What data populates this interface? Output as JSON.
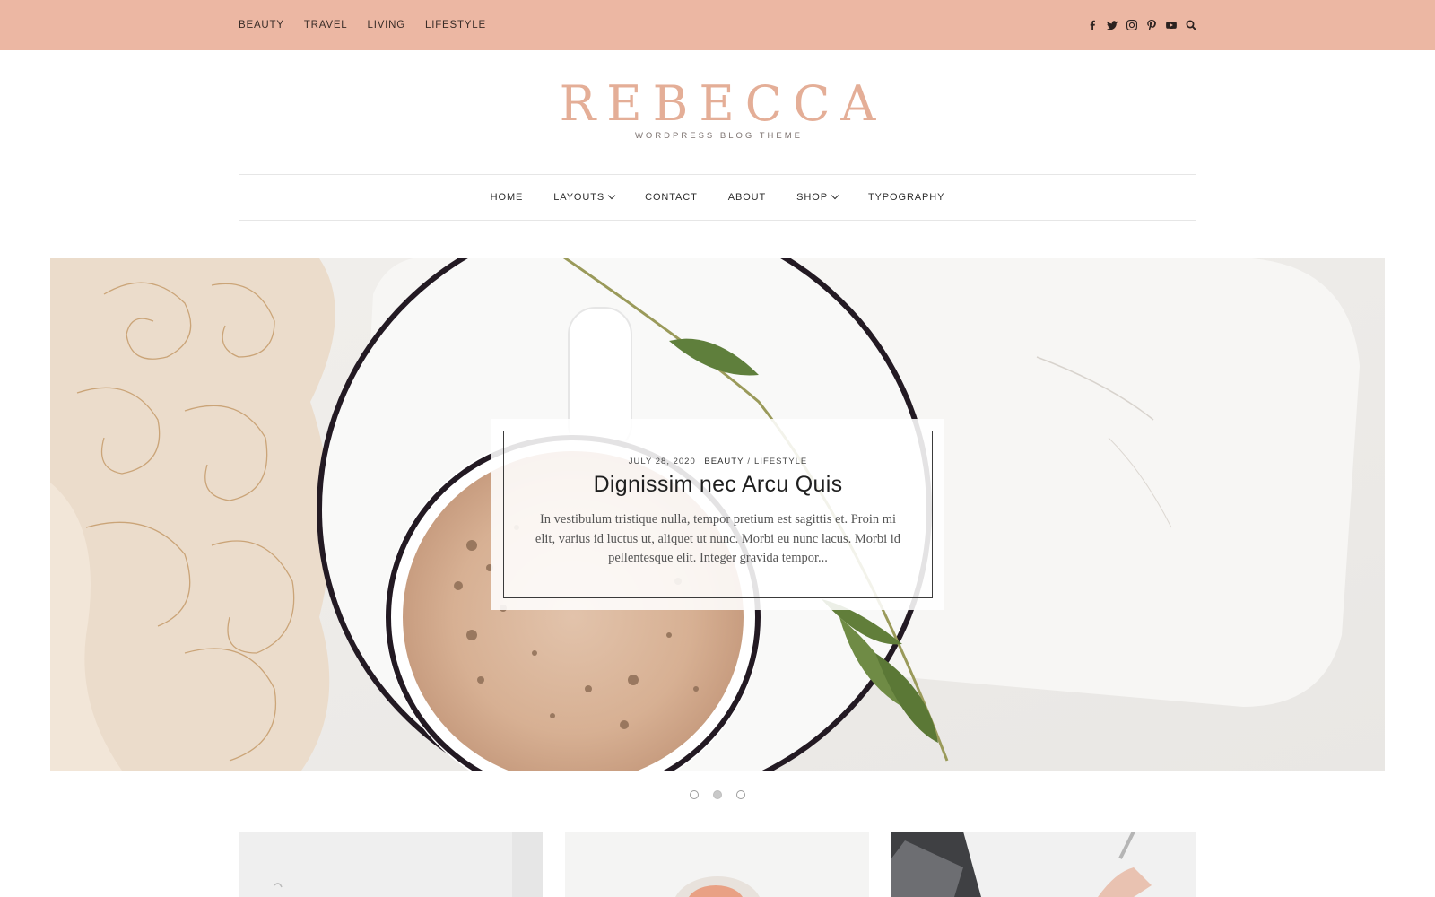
{
  "topbar": {
    "links": [
      "BEAUTY",
      "TRAVEL",
      "LIVING",
      "LIFESTYLE"
    ],
    "social_icons": [
      "facebook-icon",
      "twitter-icon",
      "instagram-icon",
      "pinterest-icon",
      "youtube-icon",
      "search-icon"
    ]
  },
  "brand": {
    "title": "REBECCA",
    "subtitle": "WORDPRESS BLOG THEME",
    "accent_color": "#e4ae97",
    "topbar_color": "#ecb7a3"
  },
  "nav": {
    "home": "HOME",
    "layouts": "LAYOUTS",
    "contact": "CONTACT",
    "about": "ABOUT",
    "shop": "SHOP",
    "typography": "TYPOGRAPHY"
  },
  "featured": {
    "date": "JULY 28, 2020",
    "category_1": "BEAUTY",
    "separator": "/",
    "category_2": "LIFESTYLE",
    "title": "Dignissim nec Arcu Quis",
    "excerpt": "In vestibulum tristique nulla, tempor pretium est sagittis et. Proin mi elit, varius id luctus ut, aliquet ut nunc. Morbi eu nunc lacus. Morbi id pellentesque elit. Integer gravida tempor..."
  },
  "slider": {
    "slide_count": 3,
    "active_slide": 2
  }
}
